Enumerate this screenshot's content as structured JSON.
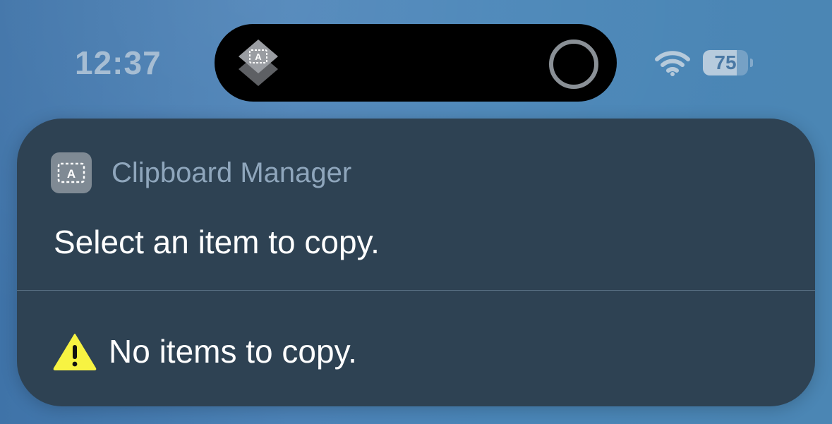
{
  "status_bar": {
    "time": "12:37",
    "battery_level": "75",
    "battery_fraction": 0.75,
    "icons": [
      "wifi-icon",
      "battery-icon"
    ]
  },
  "dynamic_island": {
    "app_icon": "shortcuts-icon",
    "progress_icon": "progress-ring-icon"
  },
  "notification": {
    "app_name": "Clipboard Manager",
    "app_icon": "clipboard-icon",
    "prompt": "Select an item to copy.",
    "items": [
      {
        "icon": "warning-icon",
        "label": "No items to copy."
      }
    ]
  },
  "colors": {
    "card_background": "#2e4253",
    "warning_yellow": "#f7f342"
  }
}
